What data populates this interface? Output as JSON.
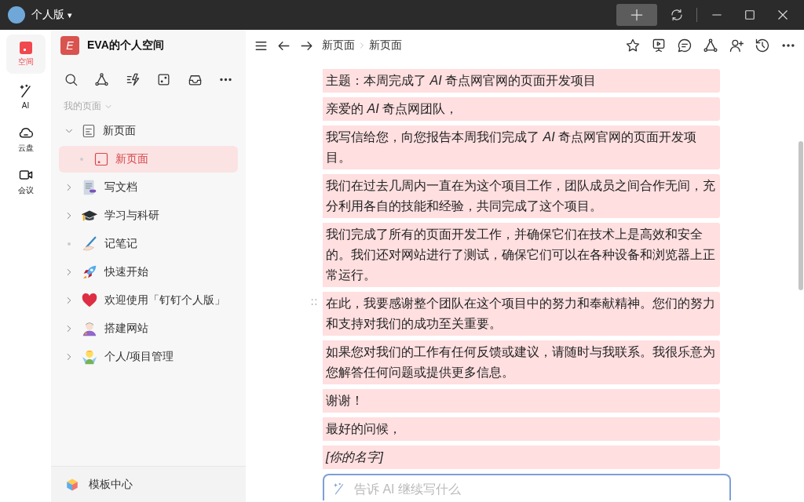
{
  "title_bar": {
    "workspace_menu": "个人版",
    "menu_caret": "▾"
  },
  "rail": {
    "items": [
      {
        "label": "空间",
        "selected": true
      },
      {
        "label": "AI",
        "selected": false
      },
      {
        "label": "云盘",
        "selected": false
      },
      {
        "label": "会议",
        "selected": false
      }
    ]
  },
  "sidebar": {
    "space_badge": "E",
    "space_name": "EVA的个人空间",
    "section_label": "我的页面",
    "tree": [
      {
        "label": "新页面",
        "kind": "folder",
        "expanded": true,
        "selected": false,
        "children": [
          {
            "label": "新页面",
            "kind": "leaf",
            "selected": true
          }
        ]
      },
      {
        "label": "写文档",
        "kind": "folder",
        "expanded": false,
        "selected": false
      },
      {
        "label": "学习与科研",
        "kind": "folder",
        "expanded": false,
        "selected": false
      },
      {
        "label": "记笔记",
        "kind": "leaf",
        "selected": false
      },
      {
        "label": "快速开始",
        "kind": "folder",
        "expanded": false,
        "selected": false
      },
      {
        "label": "欢迎使用「钉钉个人版」",
        "kind": "folder",
        "expanded": false,
        "selected": false
      },
      {
        "label": "搭建网站",
        "kind": "folder",
        "expanded": false,
        "selected": false
      },
      {
        "label": "个人/项目管理",
        "kind": "folder",
        "expanded": false,
        "selected": false
      }
    ],
    "footer": "模板中心"
  },
  "toolbar": {
    "breadcrumb": [
      "新页面",
      "新页面"
    ]
  },
  "document": {
    "paragraphs": [
      {
        "text": "主题：本周完成了 *AI* 奇点网官网的页面开发项目",
        "kind": "body",
        "hovered": false
      },
      {
        "text": "亲爱的 *AI* 奇点网团队，",
        "kind": "body",
        "hovered": false
      },
      {
        "text": "我写信给您，向您报告本周我们完成了 *AI* 奇点网官网的页面开发项目。",
        "kind": "body",
        "hovered": false
      },
      {
        "text": "我们在过去几周内一直在为这个项目工作，团队成员之间合作无间，充分利用各自的技能和经验，共同完成了这个项目。",
        "kind": "body",
        "hovered": false
      },
      {
        "text": "我们完成了所有的页面开发工作，并确保它们在技术上是高效和安全的。我们还对网站进行了测试，确保它们可以在各种设备和浏览器上正常运行。",
        "kind": "body",
        "hovered": false
      },
      {
        "text": "在此，我要感谢整个团队在这个项目中的努力和奉献精神。您们的努力和支持对我们的成功至关重要。",
        "kind": "body",
        "hovered": true
      },
      {
        "text": "如果您对我们的工作有任何反馈或建议，请随时与我联系。我很乐意为您解答任何问题或提供更多信息。",
        "kind": "body",
        "hovered": false
      },
      {
        "text": "谢谢！",
        "kind": "body",
        "hovered": false
      },
      {
        "text": "最好的问候，",
        "kind": "body",
        "hovered": false
      },
      {
        "text": "[你的名字]",
        "kind": "signature",
        "hovered": false
      }
    ],
    "ai_prompt": {
      "placeholder": "告诉 AI 继续写什么"
    }
  }
}
